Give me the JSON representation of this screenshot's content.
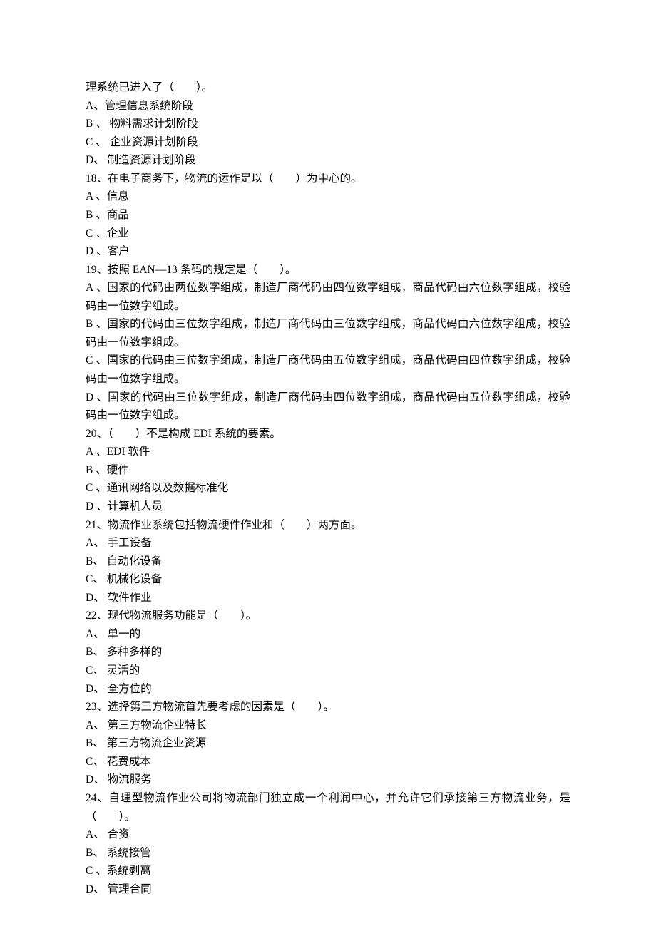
{
  "lines": [
    "理系统已进入了（　　）。",
    "A、管理信息系统阶段",
    "B 、 物料需求计划阶段",
    "C 、 企业资源计划阶段",
    "D、 制造资源计划阶段",
    "18、在电子商务下，物流的运作是以（　　）为中心的。",
    "A 、信息",
    "B 、商品",
    "C 、企业",
    "D 、客户",
    "19、按照 EAN—13 条码的规定是（　　）。",
    "A 、国家的代码由两位数字组成，制造厂商代码由四位数字组成，商品代码由六位数字组成，校验码由一位数字组成。",
    "B 、国家的代码由三位数字组成，制造厂商代码由三位数字组成，商品代码由六位数字组成，校验码由一位数字组成。",
    "C 、国家的代码由三位数字组成，制造厂商代码由五位数字组成，商品代码由四位数字组成，校验码由一位数字组成。",
    "D 、国家的代码由三位数字组成，制造厂商代码由四位数字组成，商品代码由五位数字组成，校验码由一位数字组成。",
    "20、（　　）不是构成 EDI 系统的要素。",
    "A 、EDI 软件",
    "B 、硬件",
    "C 、通讯网络以及数据标准化",
    "D 、计算机人员",
    "21、物流作业系统包括物流硬件作业和（　　）两方面。",
    "A、 手工设备",
    "B、 自动化设备",
    "C、 机械化设备",
    "D、 软件作业",
    "22、现代物流服务功能是（　　）。",
    "A、 单一的",
    "B、 多种多样的",
    "C、 灵活的",
    "D、 全方位的",
    "23、选择第三方物流首先要考虑的因素是（　　）。",
    "A、 第三方物流企业特长",
    "B、 第三方物流企业资源",
    "C、 花费成本",
    "D、 物流服务",
    "24、自理型物流作业公司将物流部门独立成一个利润中心，并允许它们承接第三方物流业务，是（　　）。",
    "A、 合资",
    "B、 系统接管",
    "C 、系统剥离",
    "D、 管理合同"
  ]
}
